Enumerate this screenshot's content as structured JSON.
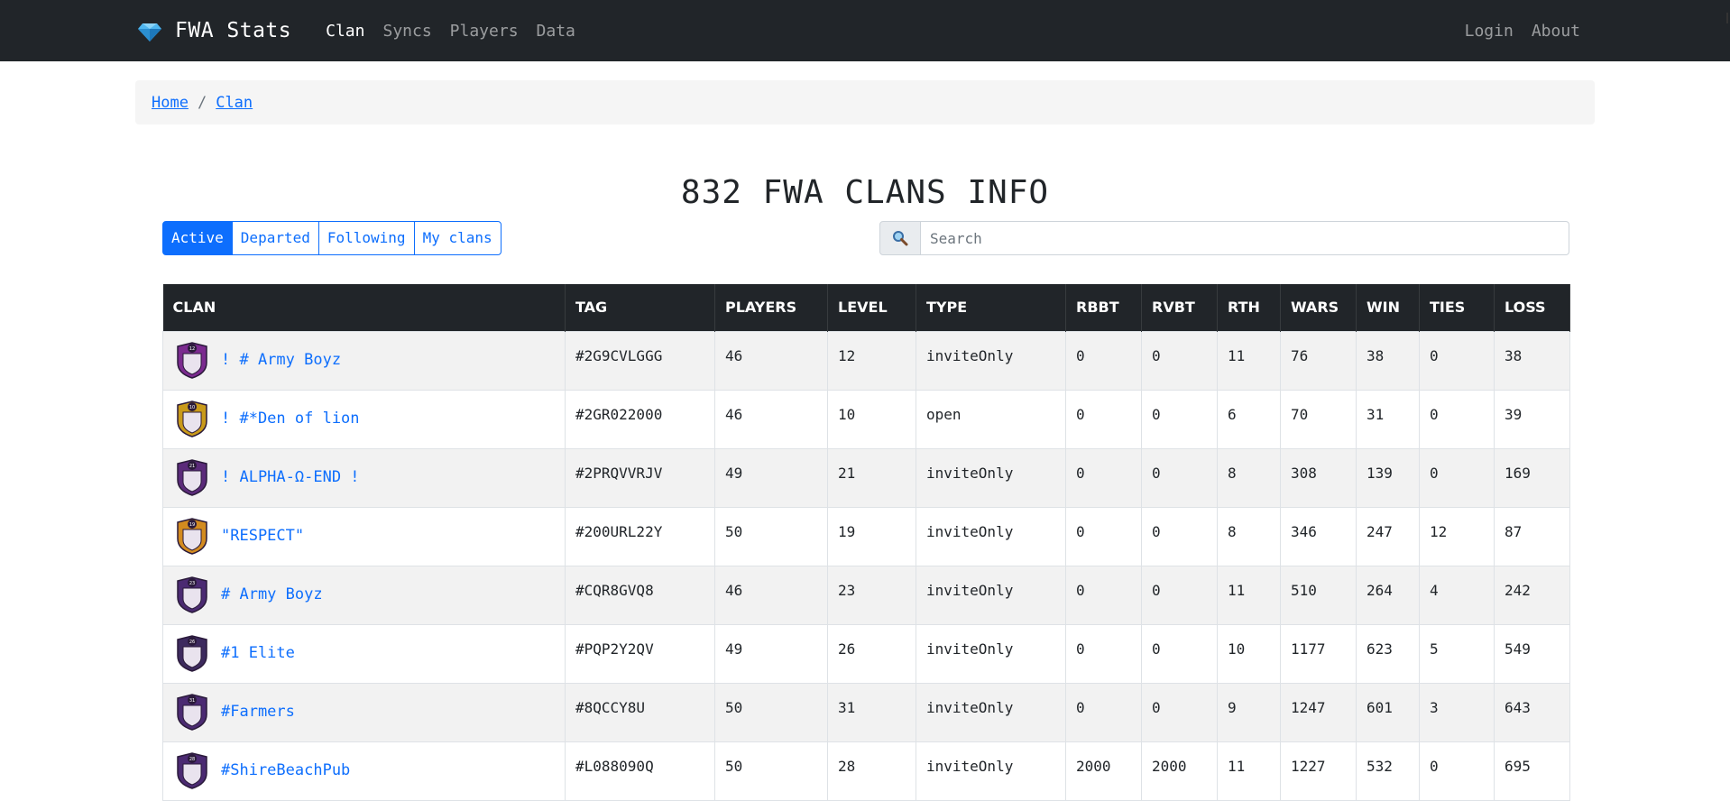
{
  "nav": {
    "brand": "FWA Stats",
    "links": [
      "Clan",
      "Syncs",
      "Players",
      "Data"
    ],
    "right_links": [
      "Login",
      "About"
    ]
  },
  "breadcrumb": [
    "Home",
    "Clan"
  ],
  "title": "832 FWA CLANS INFO",
  "filters": [
    "Active",
    "Departed",
    "Following",
    "My clans"
  ],
  "search": {
    "placeholder": "Search"
  },
  "table": {
    "headers": [
      "CLAN",
      "TAG",
      "PLAYERS",
      "LEVEL",
      "TYPE",
      "RBBT",
      "RVBT",
      "RTH",
      "WARS",
      "WIN",
      "TIES",
      "LOSS"
    ],
    "rows": [
      {
        "clan": "! # Army Boyz",
        "tag": "#2G9CVLGGG",
        "players": "46",
        "level": "12",
        "type": "inviteOnly",
        "rbbt": "0",
        "rvbt": "0",
        "rth": "11",
        "wars": "76",
        "win": "38",
        "ties": "0",
        "loss": "38",
        "badge": "purple-shield-icon",
        "badge_color": "#7b2a8f",
        "badge_level": "12"
      },
      {
        "clan": "! #*Den of lion",
        "tag": "#2GR022000",
        "players": "46",
        "level": "10",
        "type": "open",
        "rbbt": "0",
        "rvbt": "0",
        "rth": "6",
        "wars": "70",
        "win": "31",
        "ties": "0",
        "loss": "39",
        "badge": "gold-shield-icon",
        "badge_color": "#c99a1a",
        "badge_level": "10"
      },
      {
        "clan": "! ALPHA-Ω-END !",
        "tag": "#2PRQVVRJV",
        "players": "49",
        "level": "21",
        "type": "inviteOnly",
        "rbbt": "0",
        "rvbt": "0",
        "rth": "8",
        "wars": "308",
        "win": "139",
        "ties": "0",
        "loss": "169",
        "badge": "purple-red-shield-icon",
        "badge_color": "#5b2a7a",
        "badge_level": "21"
      },
      {
        "clan": "\"RESPECT\"",
        "tag": "#200URL22Y",
        "players": "50",
        "level": "19",
        "type": "inviteOnly",
        "rbbt": "0",
        "rvbt": "0",
        "rth": "8",
        "wars": "346",
        "win": "247",
        "ties": "12",
        "loss": "87",
        "badge": "orange-shield-icon",
        "badge_color": "#d38b1f",
        "badge_level": "19"
      },
      {
        "clan": "# Army Boyz",
        "tag": "#CQR8GVQ8",
        "players": "46",
        "level": "23",
        "type": "inviteOnly",
        "rbbt": "0",
        "rvbt": "0",
        "rth": "11",
        "wars": "510",
        "win": "264",
        "ties": "4",
        "loss": "242",
        "badge": "purple-shield-icon",
        "badge_color": "#4b2a72",
        "badge_level": "23"
      },
      {
        "clan": "#1 Elite",
        "tag": "#PQP2Y2QV",
        "players": "49",
        "level": "26",
        "type": "inviteOnly",
        "rbbt": "0",
        "rvbt": "0",
        "rth": "10",
        "wars": "1177",
        "win": "623",
        "ties": "5",
        "loss": "549",
        "badge": "dark-shield-icon",
        "badge_color": "#3d2a5e",
        "badge_level": "26"
      },
      {
        "clan": "#Farmers",
        "tag": "#8QCCY8U",
        "players": "50",
        "level": "31",
        "type": "inviteOnly",
        "rbbt": "0",
        "rvbt": "0",
        "rth": "9",
        "wars": "1247",
        "win": "601",
        "ties": "3",
        "loss": "643",
        "badge": "white-shield-icon",
        "badge_color": "#4b2a72",
        "badge_level": "31"
      },
      {
        "clan": "#ShireBeachPub",
        "tag": "#L088090Q",
        "players": "50",
        "level": "28",
        "type": "inviteOnly",
        "rbbt": "2000",
        "rvbt": "2000",
        "rth": "11",
        "wars": "1227",
        "win": "532",
        "ties": "0",
        "loss": "695",
        "badge": "blue-shield-icon",
        "badge_color": "#4b2a72",
        "badge_level": "28"
      }
    ]
  }
}
